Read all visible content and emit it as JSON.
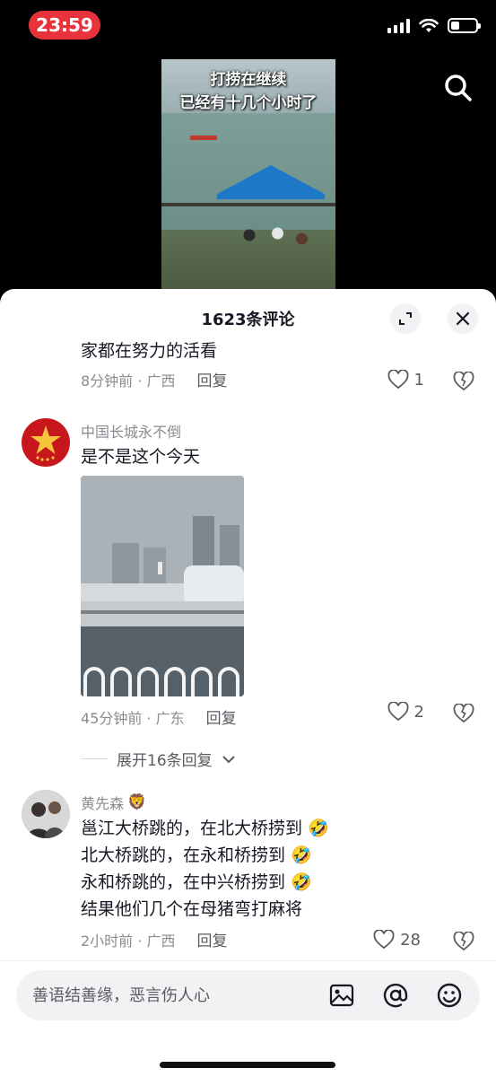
{
  "status_bar": {
    "time": "23:59",
    "battery_level": 0.35
  },
  "video": {
    "caption_line1": "打捞在继续",
    "caption_line2": "已经有十几个小时了"
  },
  "sheet": {
    "title": "1623条评论"
  },
  "comments": [
    {
      "text": "家都在努力的活看",
      "time": "8分钟前 · 广西",
      "reply_label": "回复",
      "likes": "1"
    },
    {
      "user": "中国长城永不倒",
      "text": "是不是这个今天",
      "time": "45分钟前 · 广东",
      "reply_label": "回复",
      "likes": "2",
      "expand_replies": "展开16条回复"
    },
    {
      "user": "黄先森",
      "lines": [
        "邕江大桥跳的，在北大桥捞到",
        "北大桥跳的，在永和桥捞到",
        "永和桥跳的，在中兴桥捞到",
        "结果他们几个在母猪弯打麻将"
      ],
      "time": "2小时前 · 广西",
      "reply_label": "回复",
      "likes": "28"
    }
  ],
  "input": {
    "placeholder": "善语结善缘，恶言伤人心"
  },
  "colors": {
    "time_pill": "#e8333c",
    "primary_text": "#161823",
    "secondary_text": "#8a8b91",
    "tent_blue": "#1e78c8"
  }
}
